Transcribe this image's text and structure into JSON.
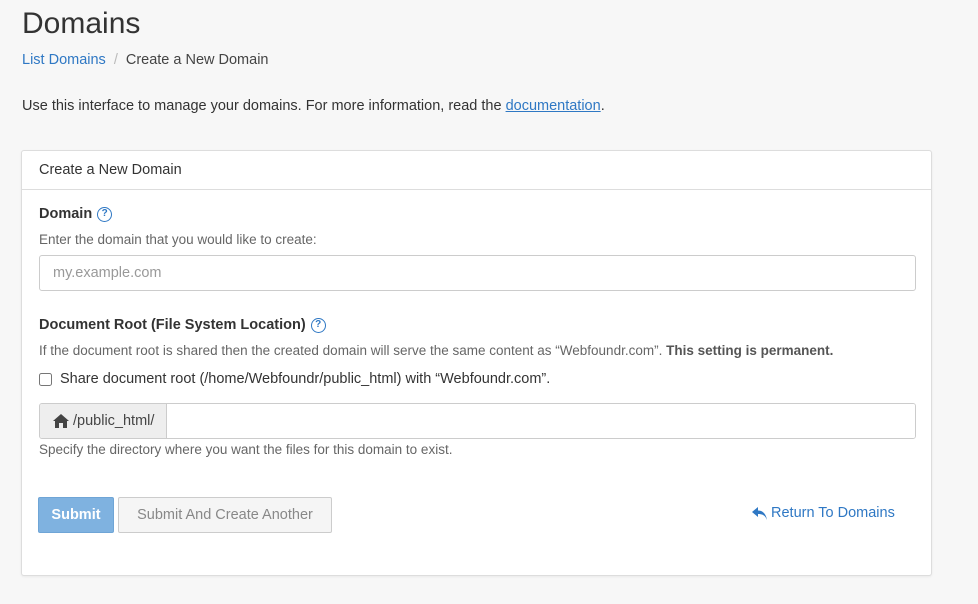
{
  "page": {
    "title": "Domains",
    "intro_text": "Use this interface to manage your domains. For more information, read the ",
    "intro_link": "documentation",
    "intro_end": "."
  },
  "breadcrumb": {
    "parent": "List Domains",
    "separator": "/",
    "current": "Create a New Domain"
  },
  "panel": {
    "heading": "Create a New Domain",
    "domain": {
      "label": "Domain",
      "help": "Enter the domain that you would like to create:",
      "placeholder": "my.example.com",
      "value": ""
    },
    "docroot": {
      "label": "Document Root (File System Location)",
      "help_prefix": "If the document root is shared then the created domain will serve the same content as “Webfoundr.com”. ",
      "help_bold": "This setting is permanent.",
      "share_label": "Share document root (/home/Webfoundr/public_html) with “Webfoundr.com”.",
      "share_checked": false,
      "prefix": "/public_html/",
      "value": "",
      "hint": "Specify the directory where you want the files for this domain to exist."
    },
    "buttons": {
      "submit": "Submit",
      "submit_another": "Submit And Create Another",
      "return": "Return To Domains"
    }
  },
  "icons": {
    "help": "question-circle-icon",
    "home": "home-icon",
    "return": "reply-arrow-icon"
  },
  "colors": {
    "link": "#2f78c4",
    "primary_button": "#7fb2e0"
  }
}
